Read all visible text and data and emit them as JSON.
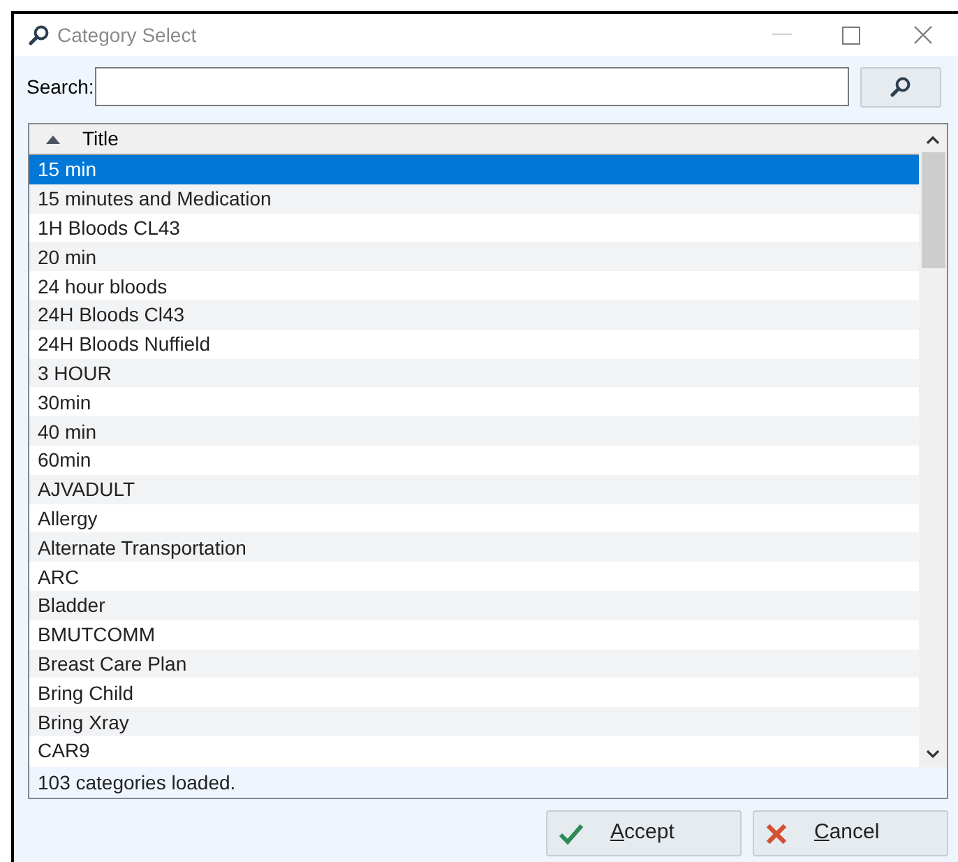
{
  "window": {
    "title": "Category Select"
  },
  "search": {
    "label": "Search:"
  },
  "list": {
    "columns": [
      {
        "label": "Title",
        "sorted_ascending": true
      }
    ],
    "rows": [
      {
        "title": "15 min",
        "selected": true
      },
      {
        "title": "15 minutes and Medication",
        "selected": false
      },
      {
        "title": "1H Bloods CL43",
        "selected": false
      },
      {
        "title": "20 min",
        "selected": false
      },
      {
        "title": "24 hour bloods",
        "selected": false
      },
      {
        "title": "24H Bloods Cl43",
        "selected": false
      },
      {
        "title": "24H Bloods Nuffield",
        "selected": false
      },
      {
        "title": "3 HOUR",
        "selected": false
      },
      {
        "title": "30min",
        "selected": false
      },
      {
        "title": "40 min",
        "selected": false
      },
      {
        "title": "60min",
        "selected": false
      },
      {
        "title": "AJVADULT",
        "selected": false
      },
      {
        "title": "Allergy",
        "selected": false
      },
      {
        "title": "Alternate Transportation",
        "selected": false
      },
      {
        "title": "ARC",
        "selected": false
      },
      {
        "title": "Bladder",
        "selected": false
      },
      {
        "title": "BMUTCOMM",
        "selected": false
      },
      {
        "title": "Breast Care Plan",
        "selected": false
      },
      {
        "title": "Bring Child",
        "selected": false
      },
      {
        "title": "Bring Xray",
        "selected": false
      },
      {
        "title": "CAR9",
        "selected": false
      }
    ],
    "status": "103 categories loaded."
  },
  "buttons": [
    {
      "kind": "accept",
      "mnemonic": "A",
      "rest": "ccept"
    },
    {
      "kind": "cancel",
      "mnemonic": "C",
      "rest": "ancel"
    }
  ]
}
